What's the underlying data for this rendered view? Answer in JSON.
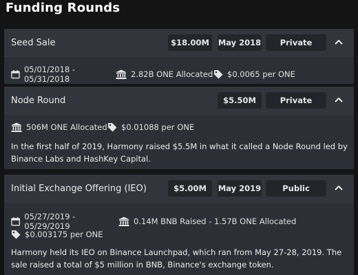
{
  "page": {
    "title": "Funding Rounds"
  },
  "rounds": [
    {
      "name": "Seed Sale",
      "amount": "$18.00M",
      "date": "May 2018",
      "type": "Private",
      "period": "05/01/2018 - 05/31/2018",
      "allocation": "2.82B ONE Allocated",
      "price": "$0.0065 per ONE"
    },
    {
      "name": "Node Round",
      "amount": "$5.50M",
      "type": "Private",
      "allocation": "506M ONE Allocated",
      "price": "$0.01088 per ONE",
      "description": "In the first half of 2019, Harmony raised $5.5M in what it called a Node Round led by Binance Labs and HashKey Capital."
    },
    {
      "name": "Initial Exchange Offering (IEO)",
      "amount": "$5.00M",
      "date": "May 2019",
      "type": "Public",
      "period": "05/27/2019 - 05/29/2019",
      "allocation": "0.14M BNB Raised - 1.57B ONE Allocated",
      "price": "$0.003175 per ONE",
      "description": "Harmony held its IEO on Binance Launchpad, which ran from May 27-28, 2019. The sale raised a total of $5 million in BNB, Binance's exchange token."
    }
  ]
}
